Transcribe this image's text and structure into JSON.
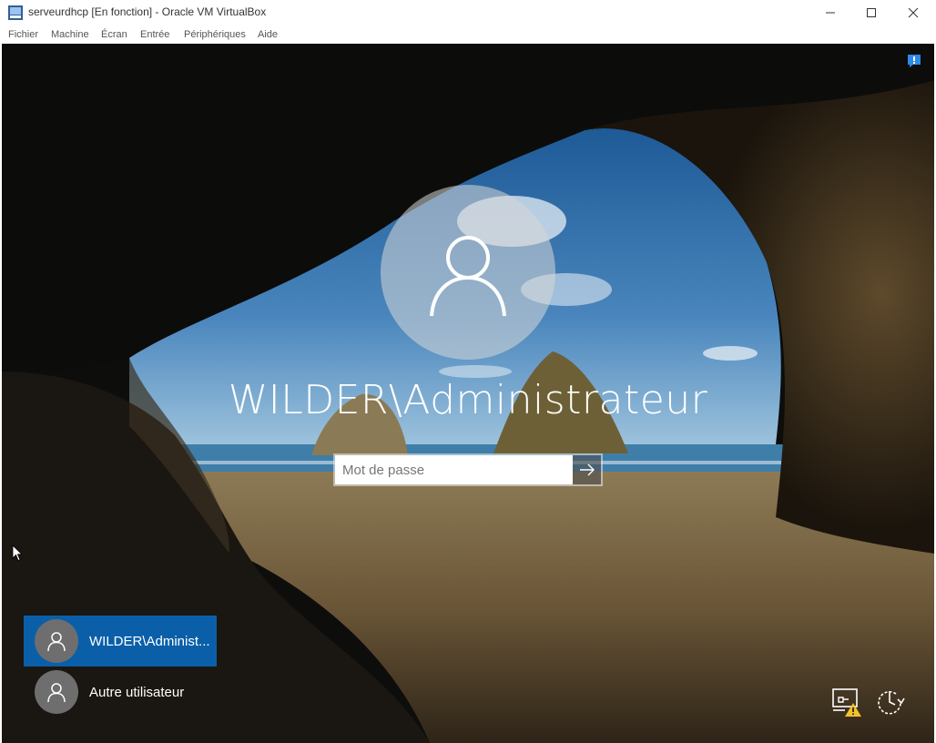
{
  "window": {
    "title": "serveurdhcp [En fonction] - Oracle VM VirtualBox",
    "app_icon": "virtualbox-vm-icon",
    "controls": [
      "minimize-icon",
      "maximize-icon",
      "close-icon"
    ]
  },
  "menu": {
    "items": [
      "Fichier",
      "Machine",
      "Écran",
      "Entrée",
      "Périphériques",
      "Aide"
    ]
  },
  "login": {
    "username": "WILDER\\Administrateur",
    "password_placeholder": "Mot de passe",
    "password_value": "",
    "submit_icon": "arrow-right-icon"
  },
  "users": [
    {
      "label": "WILDER\\Administ...",
      "selected": true
    },
    {
      "label": "Autre utilisateur",
      "selected": false
    }
  ],
  "system_icons": [
    "network-warning-icon",
    "power-icon",
    "notification-icon"
  ],
  "colors": {
    "selection": "#0a5fa8",
    "sea": "#2d6fa6",
    "sand": "#7e6a45"
  }
}
